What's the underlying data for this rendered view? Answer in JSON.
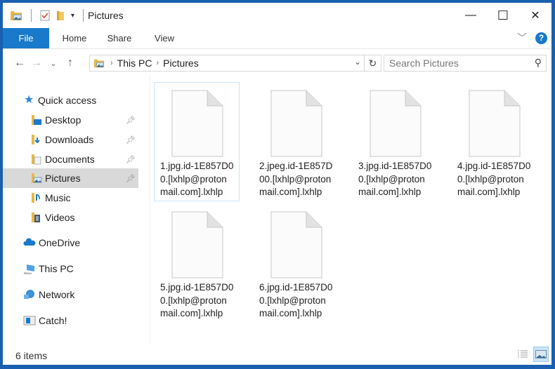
{
  "window": {
    "title": "Pictures",
    "controls": {
      "minimize": "—",
      "maximize": "☐",
      "close": "✕"
    }
  },
  "ribbon": {
    "tabs": [
      "File",
      "Home",
      "Share",
      "View"
    ],
    "help_label": "?"
  },
  "address": {
    "crumbs": [
      "This PC",
      "Pictures"
    ],
    "search_placeholder": "Search Pictures"
  },
  "sidebar": {
    "items": [
      {
        "label": "Quick access",
        "icon": "star-icon",
        "pinned": false
      },
      {
        "label": "Desktop",
        "icon": "desktop-folder-icon",
        "pinned": true
      },
      {
        "label": "Downloads",
        "icon": "downloads-folder-icon",
        "pinned": true
      },
      {
        "label": "Documents",
        "icon": "documents-folder-icon",
        "pinned": true
      },
      {
        "label": "Pictures",
        "icon": "pictures-folder-icon",
        "pinned": true,
        "selected": true
      },
      {
        "label": "Music",
        "icon": "music-folder-icon",
        "pinned": false
      },
      {
        "label": "Videos",
        "icon": "videos-folder-icon",
        "pinned": false
      },
      {
        "label": "OneDrive",
        "icon": "cloud-icon",
        "pinned": false
      },
      {
        "label": "This PC",
        "icon": "computer-icon",
        "pinned": false
      },
      {
        "label": "Network",
        "icon": "network-icon",
        "pinned": false
      },
      {
        "label": "Catch!",
        "icon": "catch-icon",
        "pinned": false
      }
    ]
  },
  "files": [
    {
      "name": "1.jpg.id-1E857D00.[lxhlp@protonmail.com].lxhlp",
      "lines": [
        "1.jpg.id-1E857D0",
        "0.[lxhlp@proton",
        "mail.com].lxhlp"
      ],
      "selected": true
    },
    {
      "name": "2.jpeg.id-1E857D00.[lxhlp@protonmail.com].lxhlp",
      "lines": [
        "2.jpeg.id-1E857D",
        "00.[lxhlp@proton",
        "mail.com].lxhlp"
      ]
    },
    {
      "name": "3.jpg.id-1E857D00.[lxhlp@protonmail.com].lxhlp",
      "lines": [
        "3.jpg.id-1E857D0",
        "0.[lxhlp@proton",
        "mail.com].lxhlp"
      ]
    },
    {
      "name": "4.jpg.id-1E857D00.[lxhlp@protonmail.com].lxhlp",
      "lines": [
        "4.jpg.id-1E857D0",
        "0.[lxhlp@proton",
        "mail.com].lxhlp"
      ]
    },
    {
      "name": "5.jpg.id-1E857D00.[lxhlp@protonmail.com].lxhlp",
      "lines": [
        "5.jpg.id-1E857D0",
        "0.[lxhlp@proton",
        "mail.com].lxhlp"
      ]
    },
    {
      "name": "6.jpg.id-1E857D00.[lxhlp@protonmail.com].lxhlp",
      "lines": [
        "6.jpg.id-1E857D0",
        "0.[lxhlp@proton",
        "mail.com].lxhlp"
      ]
    }
  ],
  "status": {
    "item_count": "6 items"
  },
  "colors": {
    "accent": "#1979ca",
    "border": "#1a5fb0",
    "selection": "#d9d9d9"
  }
}
